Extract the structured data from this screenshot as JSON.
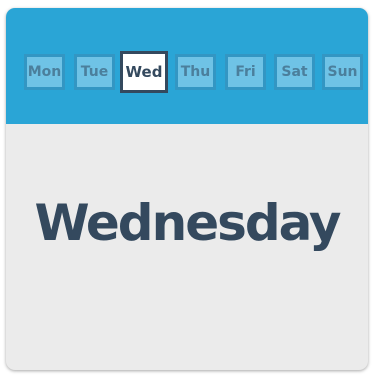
{
  "days": [
    "Mon",
    "Tue",
    "Wed",
    "Thu",
    "Fri",
    "Sat",
    "Sun"
  ],
  "selected_day": "Wed",
  "selected_day_full": "Wednesday",
  "colors": {
    "header": "#2aa5d6",
    "tab_fill": "#6fc3e6",
    "tab_border": "#3396c3",
    "selected_border": "#34495e",
    "text_dark": "#34495e",
    "card_bg": "#ebebeb"
  }
}
